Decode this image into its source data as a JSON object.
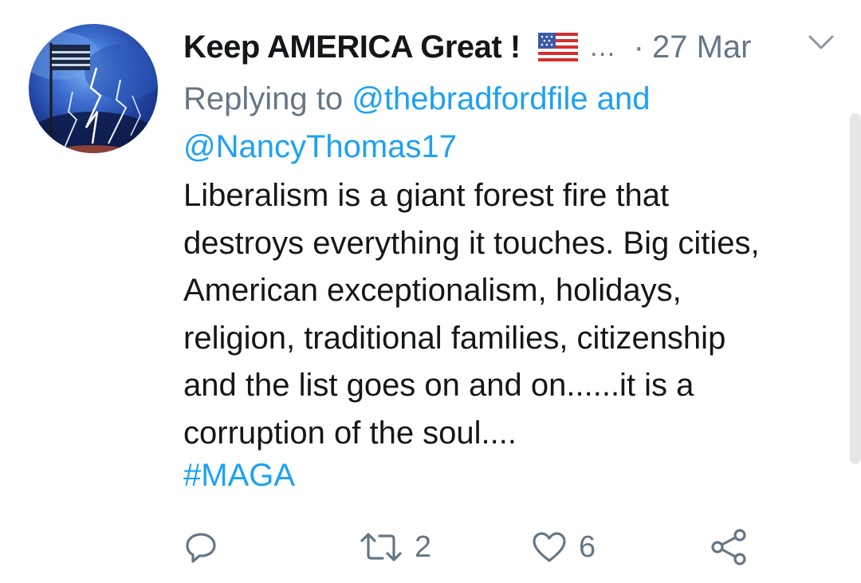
{
  "author": {
    "display_name": "Keep AMERICA Great !",
    "flag_icon": "us-flag-emoji",
    "truncation": "…",
    "separator": "·",
    "date": "27 Mar"
  },
  "reply": {
    "prefix": "Replying to",
    "mention_1": "@thebradfordfile",
    "conjunction": "and",
    "mention_2": "@NancyThomas17"
  },
  "body": {
    "lines": [
      "Liberalism is a giant forest fire that",
      "destroys everything it touches. Big cities,",
      "American exceptionalism, holidays,",
      "religion, traditional families, citizenship",
      "and the list goes on and on......it is a",
      "corruption of the soul...."
    ],
    "hashtag": "#MAGA"
  },
  "actions": {
    "reply_count": "",
    "retweet_count": "2",
    "like_count": "6"
  },
  "colors": {
    "link": "#1da1f2",
    "muted": "#657786",
    "text": "#14171a"
  }
}
